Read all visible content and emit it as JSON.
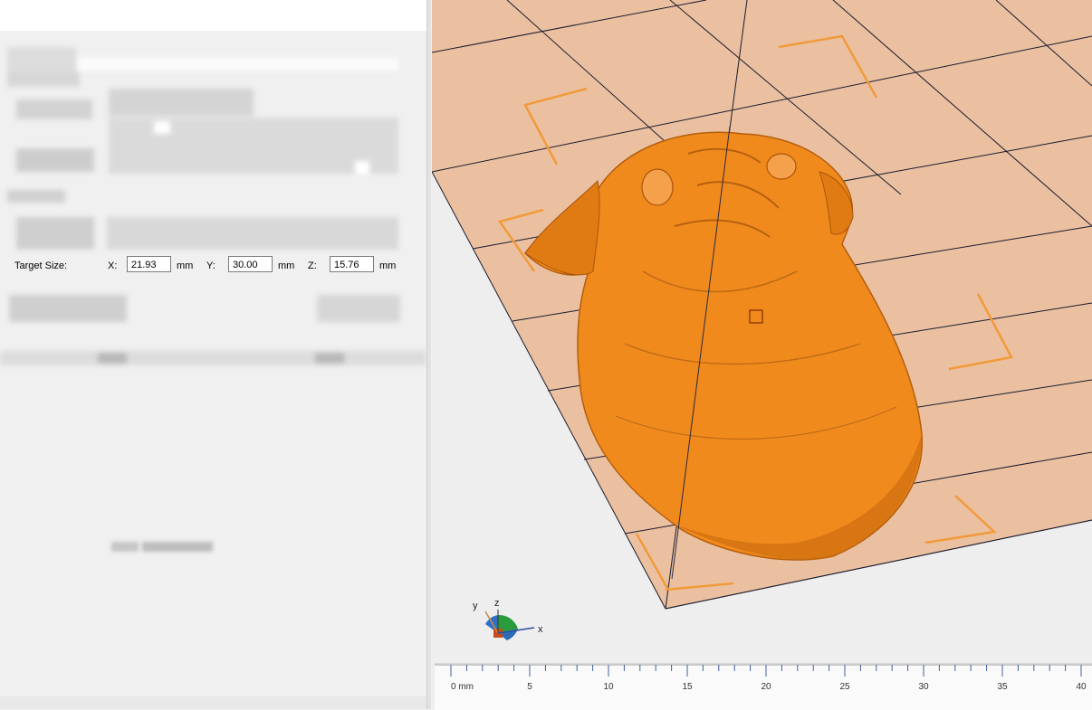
{
  "target_size": {
    "label": "Target Size:",
    "x_label": "X:",
    "x_value": "21.93",
    "y_label": "Y:",
    "y_value": "30.00",
    "z_label": "Z:",
    "z_value": "15.76",
    "unit": "mm"
  },
  "axis_gizmo": {
    "x": "x",
    "y": "y",
    "z": "z"
  },
  "ruler": {
    "first_label": "0 mm",
    "labels": [
      "5",
      "10",
      "15",
      "20",
      "25",
      "30",
      "35",
      "40"
    ]
  },
  "colors": {
    "model": "#f08a1c",
    "bed": "#eac0a0",
    "bed_lines": "#1a1a2e",
    "corner_markers": "#f29a3a",
    "panel_bg": "#f0f0f0"
  }
}
